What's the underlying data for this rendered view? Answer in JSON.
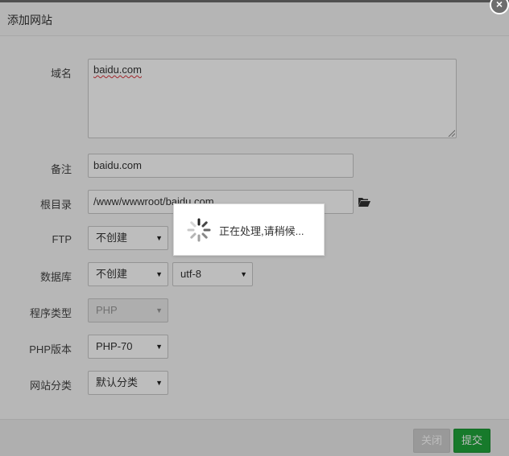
{
  "dialog": {
    "title": "添加网站",
    "close_glyph": "×"
  },
  "form": {
    "domain": {
      "label": "域名",
      "value": "baidu.com"
    },
    "remark": {
      "label": "备注",
      "value": "baidu.com"
    },
    "root_dir": {
      "label": "根目录",
      "value": "/www/wwwroot/baidu.com"
    },
    "ftp": {
      "label": "FTP",
      "selected": "不创建"
    },
    "database": {
      "label": "数据库",
      "selected": "不创建",
      "charset": "utf-8"
    },
    "program_type": {
      "label": "程序类型",
      "selected": "PHP"
    },
    "php_version": {
      "label": "PHP版本",
      "selected": "PHP-70"
    },
    "site_category": {
      "label": "网站分类",
      "selected": "默认分类"
    }
  },
  "footer": {
    "close_label": "关闭",
    "submit_label": "提交"
  },
  "loading": {
    "message": "正在处理,请稍候..."
  },
  "colors": {
    "submit": "#20a53a",
    "close_disabled": "#cfcfcf",
    "overlay": "rgba(0,0,0,0.26)"
  }
}
